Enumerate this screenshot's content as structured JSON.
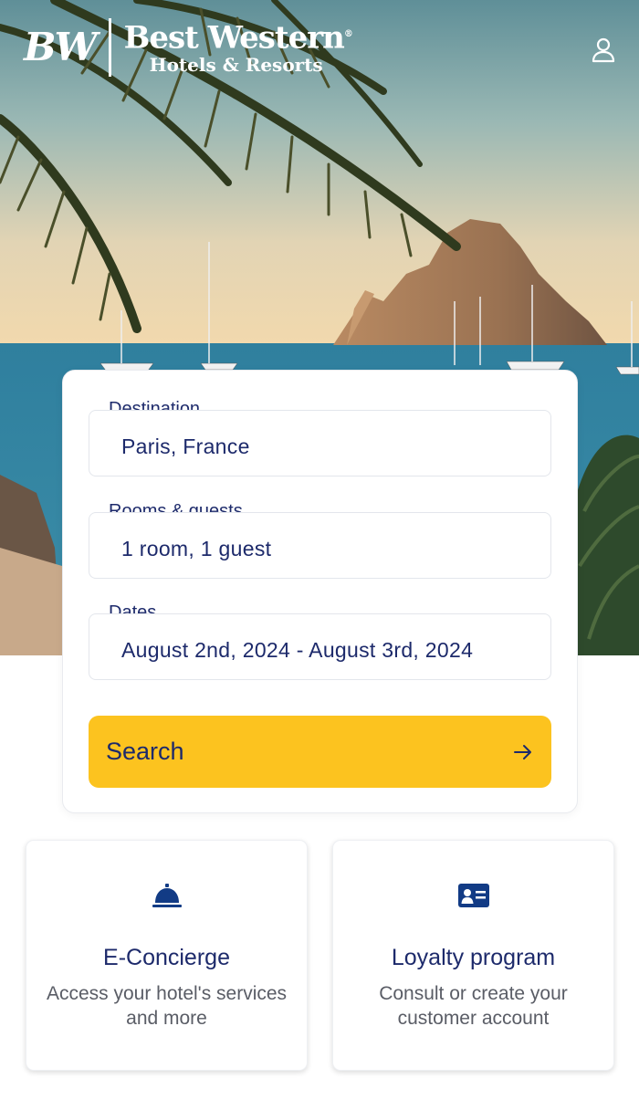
{
  "brand": {
    "monogram": "BW",
    "name": "Best Western",
    "registered_mark": "®",
    "tagline": "Hotels & Resorts"
  },
  "search_form": {
    "destination": {
      "label": "Destination",
      "value": "Paris, France"
    },
    "rooms_guests": {
      "label": "Rooms & guests",
      "value": "1 room, 1 guest"
    },
    "dates": {
      "label": "Dates",
      "value": "August 2nd, 2024 - August 3rd, 2024"
    },
    "search_button": "Search"
  },
  "tiles": [
    {
      "icon": "concierge-bell-icon",
      "title": "E-Concierge",
      "description": "Access your hotel's services and more"
    },
    {
      "icon": "id-card-icon",
      "title": "Loyalty program",
      "description": "Consult or create your customer account"
    }
  ],
  "colors": {
    "primary_navy": "#1d2a6b",
    "accent_yellow": "#fcc31f",
    "icon_blue": "#123b85"
  }
}
